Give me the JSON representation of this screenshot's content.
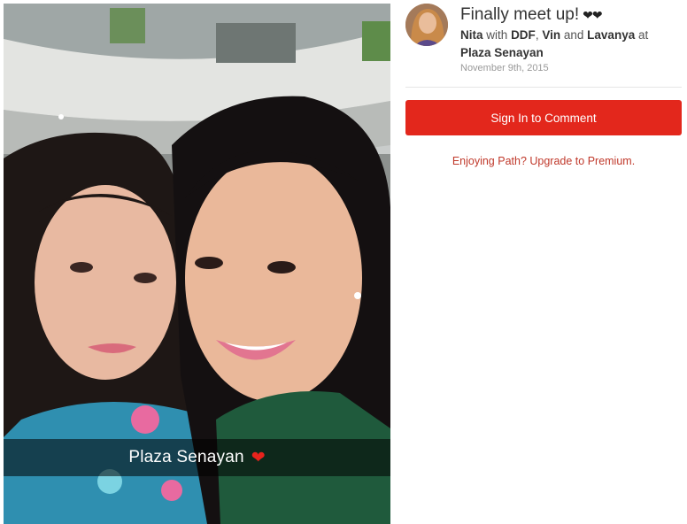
{
  "photo": {
    "caption": "Plaza Senayan",
    "caption_icon": "red-heart-icon"
  },
  "post": {
    "title": "Finally meet up!",
    "title_emoji": "❤❤",
    "author": "Nita",
    "with_word": "with",
    "friends": [
      "DDF",
      "Vin",
      "Lavanya"
    ],
    "sep_comma": ",",
    "and_word": "and",
    "at_word": "at",
    "place": "Plaza Senayan",
    "date": "November 9th, 2015"
  },
  "actions": {
    "signin_label": "Sign In to Comment",
    "upgrade_label": "Enjoying Path? Upgrade to Premium."
  },
  "colors": {
    "brand_red": "#e3271c",
    "link_red": "#c0392b"
  }
}
